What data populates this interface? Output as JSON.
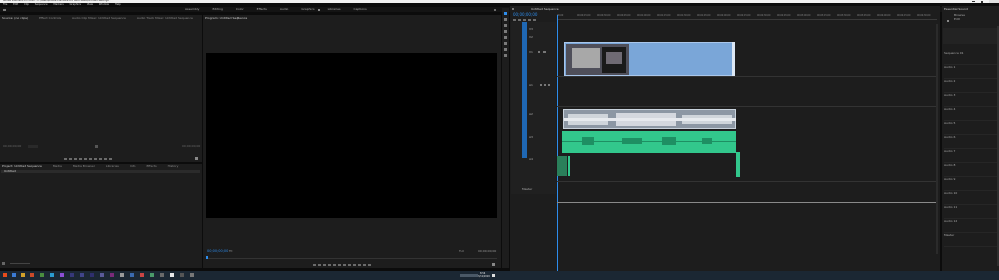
{
  "window": {
    "title": "Adobe Premiere Pro 2020 - C:\\Users\\Adobe Premiere Pro Auto-Save\\Untitled Settings *"
  },
  "menu": [
    "File",
    "Edit",
    "Clip",
    "Sequence",
    "Markers",
    "Graphics",
    "View",
    "Window",
    "Help"
  ],
  "workspaces": [
    "Assembly",
    "Editing",
    "Color",
    "Effects",
    "Audio",
    "Graphics",
    "Libraries",
    "Captions"
  ],
  "source_tabs": [
    "Source: (no clips)",
    "Effect Controls",
    "Audio Clip Mixer: Untitled Sequence",
    "Audio Track Mixer: Untitled Sequence",
    "Metadata"
  ],
  "program": {
    "tab": "Program: Untitled Sequence",
    "timecode": "00;00;00;00",
    "fit": "Fit",
    "full": "Full",
    "duration": "00;00;00;00"
  },
  "source": {
    "timecode_left": "00;00;00;00",
    "timecode_right": "00;00;00;00"
  },
  "project_tabs": [
    "Project: Untitled Sequence",
    "Media",
    "Media Browser",
    "Libraries",
    "Info",
    "Effects",
    "History"
  ],
  "project_item": "Untitled",
  "timeline": {
    "tab": "Untitled Sequence",
    "timecode": "00;00;00;00",
    "ruler": [
      "00;00",
      "00;00;15;00",
      "00;00;30;00",
      "00;00;45;00",
      "00;01;00;00",
      "00;01;15;00",
      "00;01;30;00",
      "00;01;45;00",
      "00;02;00;00",
      "00;02;15;00",
      "00;02;30;00",
      "00;02;45;00",
      "00;03;00;00",
      "00;03;15;00",
      "00;03;30;00",
      "00;03;45;00",
      "00;04;00;00",
      "00;04;15;00",
      "00;04;30;00"
    ],
    "video_tracks": [
      "V3",
      "V2",
      "V1"
    ],
    "audio_tracks": [
      "A1",
      "A2",
      "A3",
      "A4"
    ],
    "master": "Master"
  },
  "mixer": {
    "title": "Essential Sound",
    "tabs": [
      "Browse",
      "Edit"
    ],
    "rows": [
      "Sequence 01",
      "Audio 1",
      "Audio 2",
      "Audio 3",
      "Audio 4",
      "Audio 5",
      "Audio 6",
      "Audio 7",
      "Audio 8",
      "Audio 9",
      "Audio 10",
      "Audio 11",
      "Audio 12",
      "Master"
    ]
  },
  "taskbar": {
    "time": "8:56",
    "date": "3/11/2020"
  },
  "colors": {
    "accent": "#2d8ceb",
    "video_clip": "#7aa6d8",
    "audio_clip": "#32c78c",
    "panel": "#1d1d1d"
  }
}
